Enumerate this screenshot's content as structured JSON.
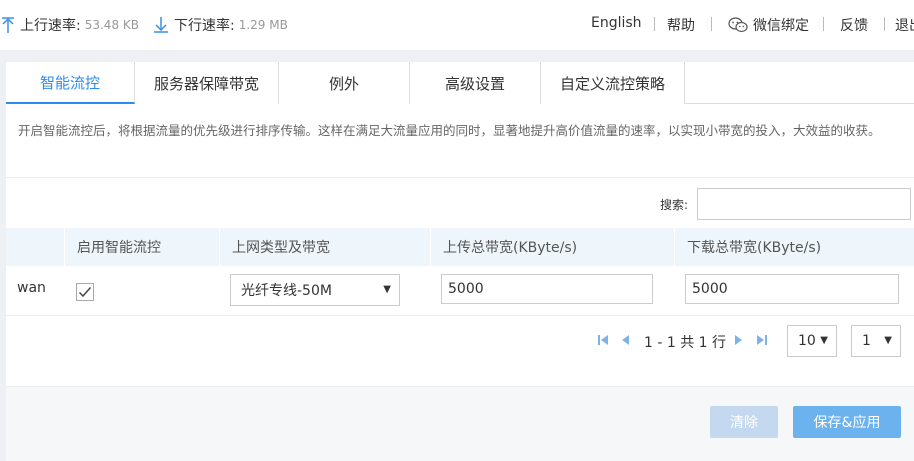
{
  "topbar": {
    "upload_label": "上行速率:",
    "upload_value": "53.48 KB",
    "download_label": "下行速率:",
    "download_value": "1.29 MB",
    "links": {
      "english": "English",
      "help": "帮助",
      "wechat": "微信绑定",
      "feedback": "反馈",
      "logout": "退出"
    }
  },
  "tabs": [
    "智能流控",
    "服务器保障带宽",
    "例外",
    "高级设置",
    "自定义流控策略"
  ],
  "description": "开启智能流控后，将根据流量的优先级进行排序传输。这样在满足大流量应用的同时，显著地提升高价值流量的速率，以实现小带宽的投入，大效益的收获。",
  "search": {
    "label": "搜索:",
    "value": ""
  },
  "table": {
    "headers": [
      "启用智能流控",
      "上网类型及带宽",
      "上传总带宽(KByte/s)",
      "下载总带宽(KByte/s)"
    ],
    "rows": [
      {
        "name": "wan",
        "enabled": true,
        "line_type": "光纤专线-50M",
        "upload": "5000",
        "download": "5000"
      }
    ]
  },
  "pager": {
    "info": "1 - 1 共 1 行",
    "page_size": "10",
    "page": "1"
  },
  "buttons": {
    "clear": "清除",
    "save": "保存&应用"
  },
  "colors": {
    "accent": "#2d8cf0",
    "save_button": "#6cb2ee",
    "clear_button": "#c4d9ef",
    "header_bg": "#eef6fb"
  }
}
